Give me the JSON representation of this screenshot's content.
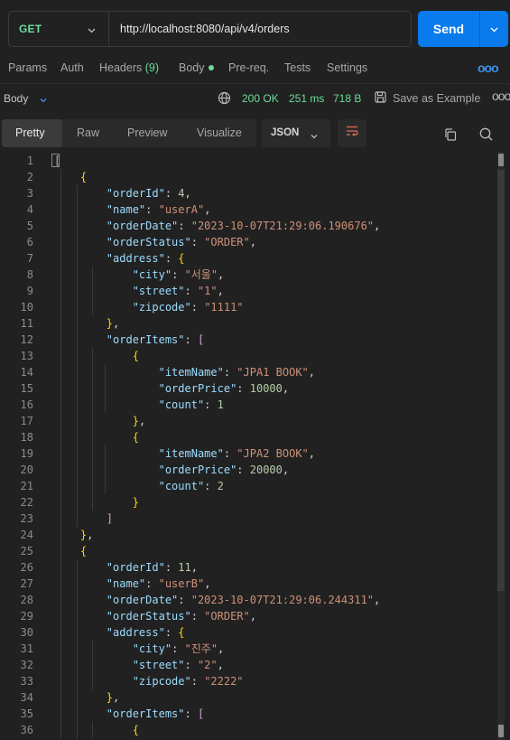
{
  "request": {
    "method": "GET",
    "url": "http://localhost:8080/api/v4/orders",
    "send_label": "Send"
  },
  "tabs": {
    "params": "Params",
    "auth": "Auth",
    "headers": "Headers",
    "headers_count": "(9)",
    "body": "Body",
    "prereq": "Pre-req.",
    "tests": "Tests",
    "settings": "Settings",
    "more": "ooo"
  },
  "response": {
    "body_label": "Body",
    "status": "200 OK",
    "time": "251 ms",
    "size": "718 B",
    "save_label": "Save as Example",
    "more": "ooo"
  },
  "viewer": {
    "modes": [
      "Pretty",
      "Raw",
      "Preview",
      "Visualize"
    ],
    "active_mode": "Pretty",
    "format": "JSON"
  },
  "code_lines": [
    "[",
    "  {",
    "    \"orderId\": 4,",
    "    \"name\": \"userA\",",
    "    \"orderDate\": \"2023-10-07T21:29:06.190676\",",
    "    \"orderStatus\": \"ORDER\",",
    "    \"address\": {",
    "      \"city\": \"서울\",",
    "      \"street\": \"1\",",
    "      \"zipcode\": \"1111\"",
    "    },",
    "    \"orderItems\": [",
    "      {",
    "        \"itemName\": \"JPA1 BOOK\",",
    "        \"orderPrice\": 10000,",
    "        \"count\": 1",
    "      },",
    "      {",
    "        \"itemName\": \"JPA2 BOOK\",",
    "        \"orderPrice\": 20000,",
    "        \"count\": 2",
    "      }",
    "    ]",
    "  },",
    "  {",
    "    \"orderId\": 11,",
    "    \"name\": \"userB\",",
    "    \"orderDate\": \"2023-10-07T21:29:06.244311\",",
    "    \"orderStatus\": \"ORDER\",",
    "    \"address\": {",
    "      \"city\": \"진주\",",
    "      \"street\": \"2\",",
    "      \"zipcode\": \"2222\"",
    "    },",
    "    \"orderItems\": [",
    "      {"
  ],
  "colors": {
    "accent": "#097bed",
    "method_get": "#6bdd9a",
    "status_ok": "#6bdd9a",
    "json_key": "#9cdcfe",
    "json_string": "#ce9178",
    "json_number": "#b5cea8"
  },
  "icons": {
    "method_dropdown": "chevron-down-icon",
    "send_dropdown": "chevron-down-icon",
    "body_dropdown": "chevron-down-icon",
    "globe": "globe-icon",
    "save": "save-icon",
    "format_dropdown": "chevron-down-icon",
    "wrap": "wrap-lines-icon",
    "copy": "copy-icon",
    "search": "search-icon"
  }
}
